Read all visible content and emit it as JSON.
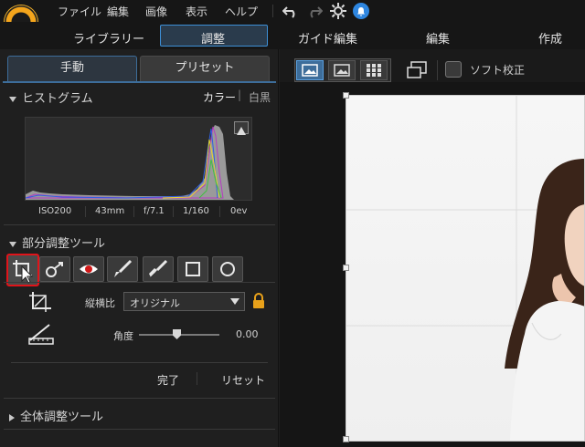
{
  "menubar": {
    "items": [
      "ファイル",
      "編集",
      "画像",
      "表示",
      "ヘルプ"
    ]
  },
  "modes": {
    "tabs": [
      "ライブラリー",
      "調整",
      "ガイド編集",
      "編集",
      "作成"
    ],
    "active": "調整"
  },
  "left_tabs": {
    "manual": "手動",
    "preset": "プリセット"
  },
  "histogram": {
    "title": "ヒストグラム",
    "color_label": "カラー",
    "separator": "|",
    "mono_label": "白黒",
    "exif": [
      "ISO200",
      "43mm",
      "f/7.1",
      "1/160",
      "0ev"
    ]
  },
  "local_tools": {
    "title": "部分調整ツール",
    "tool_icons": [
      "crop-icon",
      "clone-icon",
      "red-eye-icon",
      "brush-icon",
      "eraser-brush-icon",
      "square-mask-icon",
      "circle-mask-icon"
    ]
  },
  "crop": {
    "aspect_label": "縦横比",
    "aspect_value": "オリジナル",
    "angle_label": "角度",
    "angle_value": "0.00",
    "done_label": "完了",
    "reset_label": "リセット"
  },
  "global_tools": {
    "title": "全体調整ツール"
  },
  "viewer_toolbar": {
    "soft_proof_label": "ソフト校正"
  },
  "colors": {
    "accent": "#3d8fd6",
    "highlight": "#e0141a",
    "lock": "#e8a11a"
  }
}
